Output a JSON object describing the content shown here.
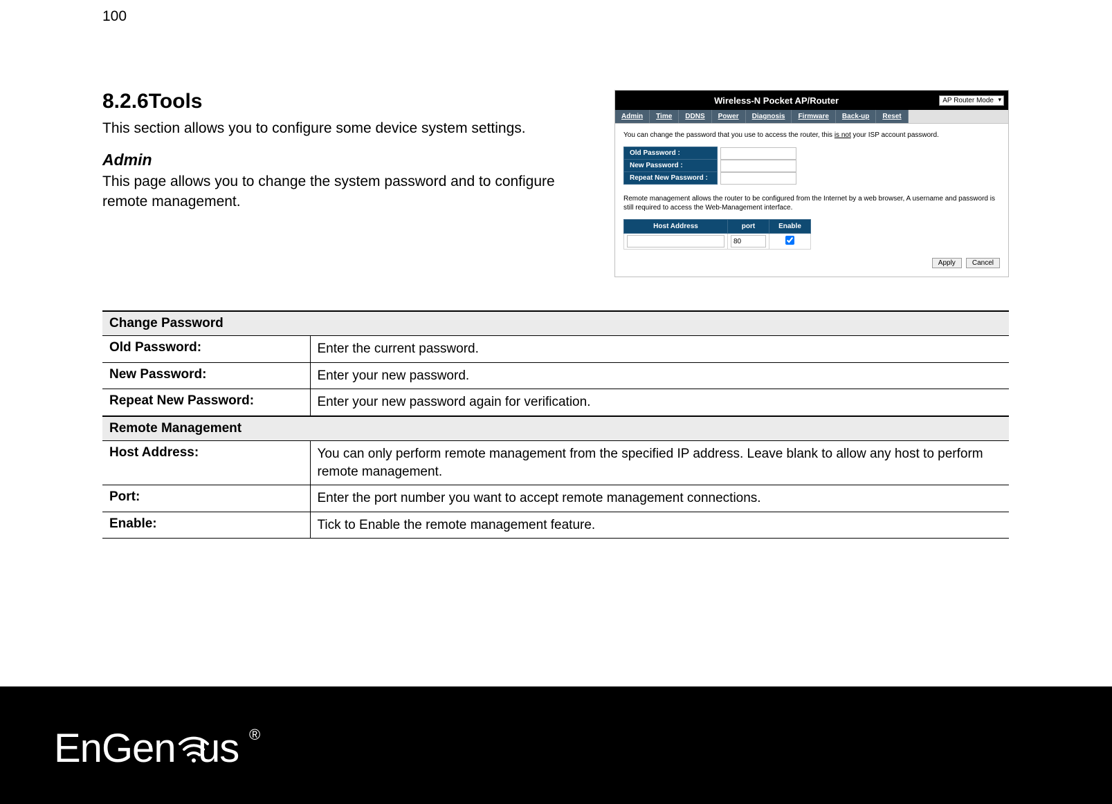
{
  "page_number": "100",
  "section": {
    "heading": "8.2.6Tools",
    "description": "This section allows you to configure some device system settings.",
    "sub_heading": "Admin",
    "sub_description": "This page allows you to change the system password and to configure remote management."
  },
  "screenshot": {
    "titlebar": "Wireless-N Pocket AP/Router",
    "mode_dropdown": "AP Router Mode",
    "tabs": [
      "Admin",
      "Time",
      "DDNS",
      "Power",
      "Diagnosis",
      "Firmware",
      "Back-up",
      "Reset"
    ],
    "note_pre": "You can change the password that you use to access the router, this ",
    "note_underline": "is not",
    "note_post": " your ISP account password.",
    "pw_rows": [
      "Old Password :",
      "New Password :",
      "Repeat New Password :"
    ],
    "remote_note": "Remote management allows the router to be configured from the Internet by a web browser, A username and password is still required to access the Web-Management interface.",
    "rm_headers": [
      "Host Address",
      "port",
      "Enable"
    ],
    "rm_port_value": "80",
    "rm_enable_checked": true,
    "apply_label": "Apply",
    "cancel_label": "Cancel"
  },
  "desc_table": {
    "section1_title": "Change Password",
    "rows1": [
      {
        "k": "Old Password:",
        "v": "Enter the current password."
      },
      {
        "k": "New Password:",
        "v": "Enter your new password."
      },
      {
        "k": "Repeat New Password:",
        "v": "Enter your new password again for verification."
      }
    ],
    "section2_title": "Remote Management",
    "rows2": [
      {
        "k": "Host Address:",
        "v": "You can only perform remote management from the specified IP address. Leave blank to allow any host to perform remote management."
      },
      {
        "k": "Port:",
        "v": "Enter the port number you want to accept remote management connections."
      },
      {
        "k": "Enable:",
        "v": "Tick to Enable the remote management feature."
      }
    ]
  },
  "footer": {
    "logo_text": "EnGenius",
    "registered": "®"
  }
}
